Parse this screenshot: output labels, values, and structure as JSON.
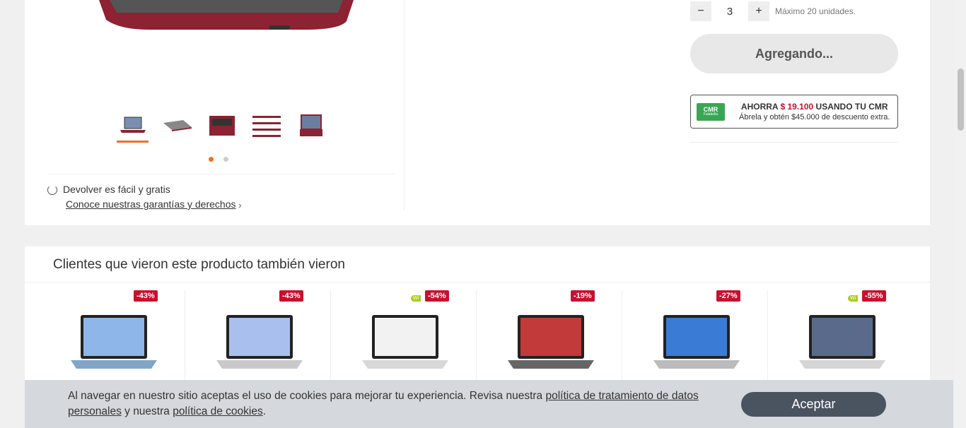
{
  "gallery": {
    "thumbnails": [
      "laptop-front-icon",
      "laptop-side-icon",
      "laptop-keyboard-icon",
      "laptop-stack-icon",
      "laptop-open-icon"
    ],
    "active_thumbnail": 0,
    "dots": 2,
    "active_dot": 0
  },
  "returns": {
    "label": "Devolver es fácil y gratis",
    "link": "Conoce nuestras garantías y derechos",
    "chevron": "›"
  },
  "purchase": {
    "qty_minus": "−",
    "qty_value": "3",
    "qty_plus": "+",
    "qty_max": "Máximo 20 unidades.",
    "add_button": "Agregando..."
  },
  "cmr": {
    "logo_text": "CMR",
    "logo_sub": "Falabella",
    "line1_prefix": "AHORRA",
    "amount": "$ 19.100",
    "line1_suffix": "USANDO TU CMR",
    "line2": "Ábrela y obtén $45.000 de descuento extra."
  },
  "recommendations": {
    "title": "Clientes que vieron este producto también vieron",
    "products": [
      {
        "discount": "-43%",
        "wi": false,
        "screen": "#8fb6e8",
        "body": "#7fa6c8"
      },
      {
        "discount": "-43%",
        "wi": false,
        "screen": "#a9c0ef",
        "body": "#c9c9c9"
      },
      {
        "discount": "-54%",
        "wi": true,
        "wi_label": "Wi",
        "screen": "#f2f2f2",
        "body": "#d8d8d8"
      },
      {
        "discount": "-19%",
        "wi": false,
        "screen": "#c23a3a",
        "body": "#666"
      },
      {
        "discount": "-27%",
        "wi": false,
        "screen": "#3a7bd5",
        "body": "#bbb"
      },
      {
        "discount": "-55%",
        "wi": true,
        "wi_label": "Wi",
        "screen": "#5a6a8a",
        "body": "#d5d5d5"
      }
    ]
  },
  "cookie": {
    "text_before": "Al navegar en nuestro sitio aceptas el uso de cookies para mejorar tu experiencia. Revisa nuestra ",
    "link1": "política de tratamiento de datos personales",
    "text_middle": " y nuestra ",
    "link2": "política de cookies",
    "text_after": ".",
    "accept": "Aceptar"
  }
}
